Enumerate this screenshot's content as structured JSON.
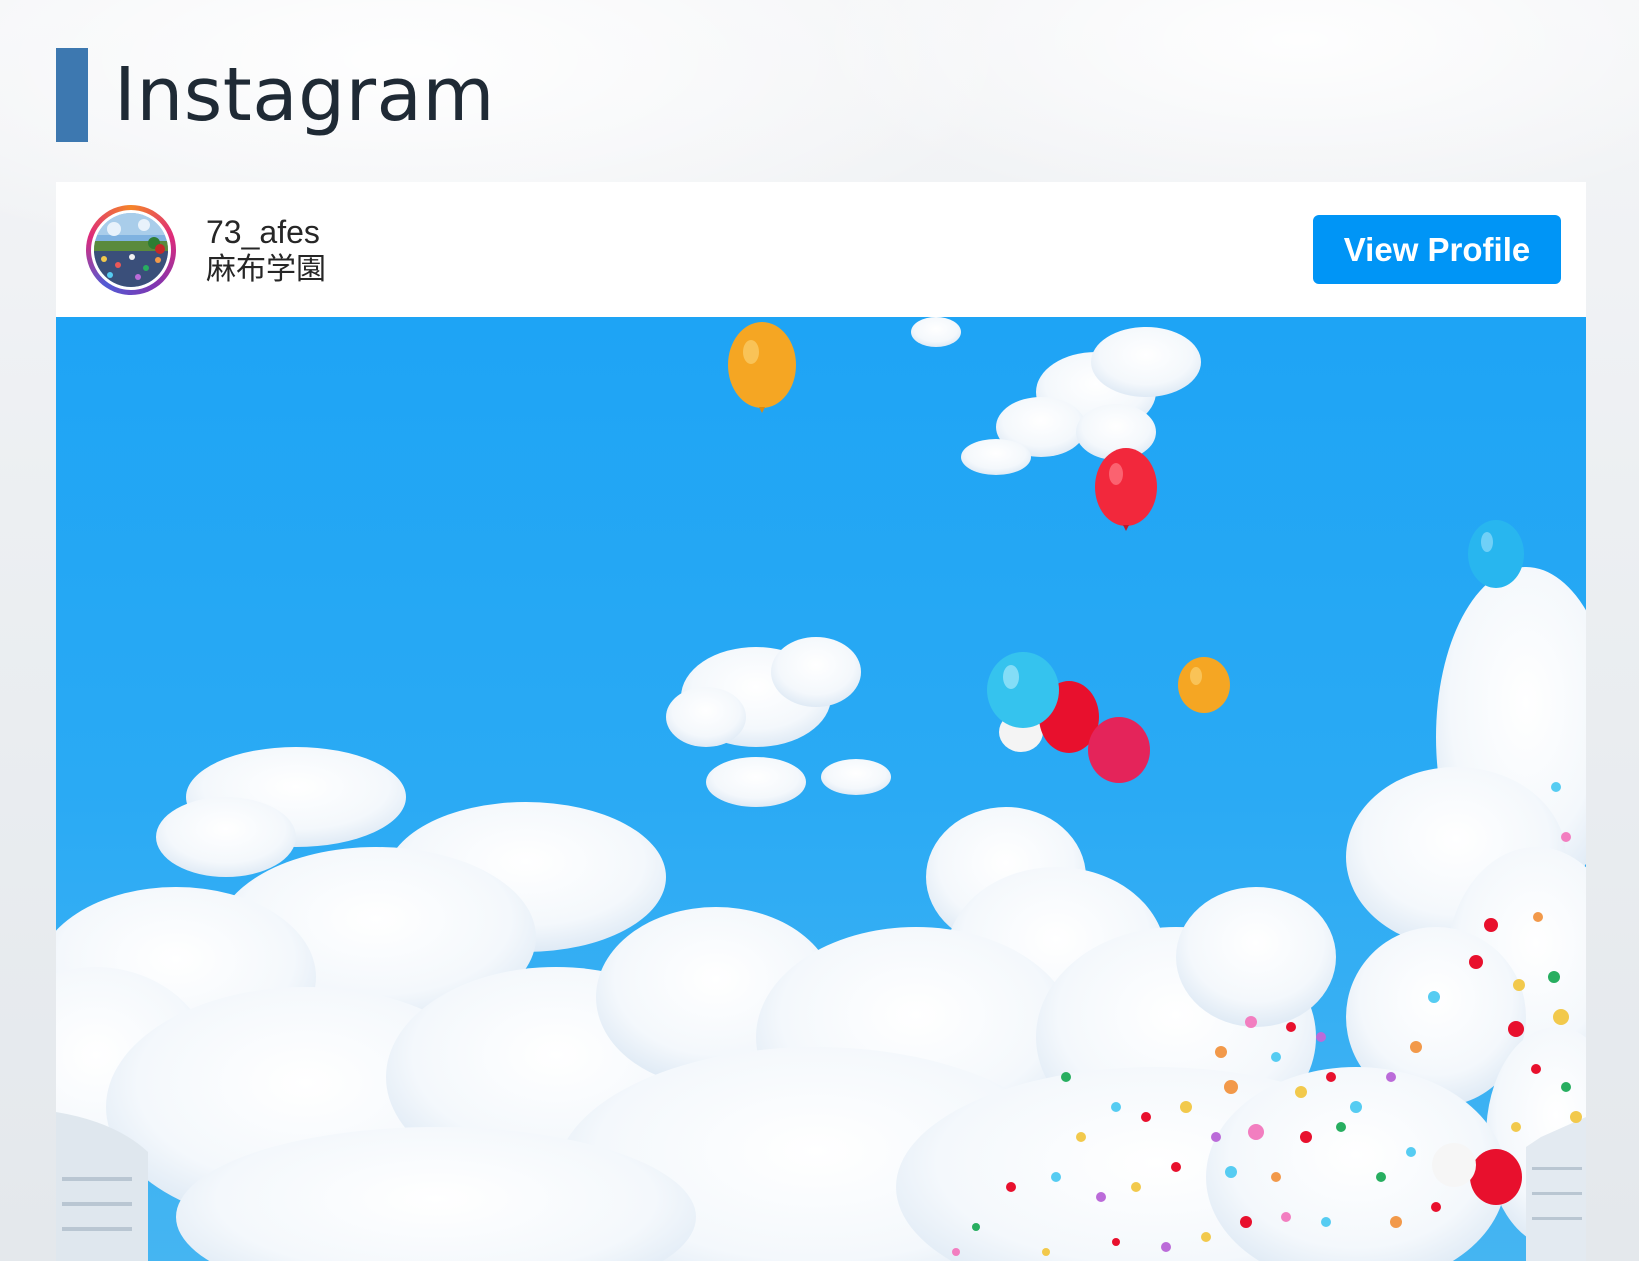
{
  "section": {
    "title": "Instagram"
  },
  "feed": {
    "profile": {
      "username": "73_afes",
      "display_name": "麻布学園",
      "avatar_icon": "profile-avatar-icon"
    },
    "view_profile_label": "View Profile",
    "colors": {
      "accent_bar": "#3d78b0",
      "button": "#0095f6",
      "sky": "#1ea4f5"
    }
  }
}
